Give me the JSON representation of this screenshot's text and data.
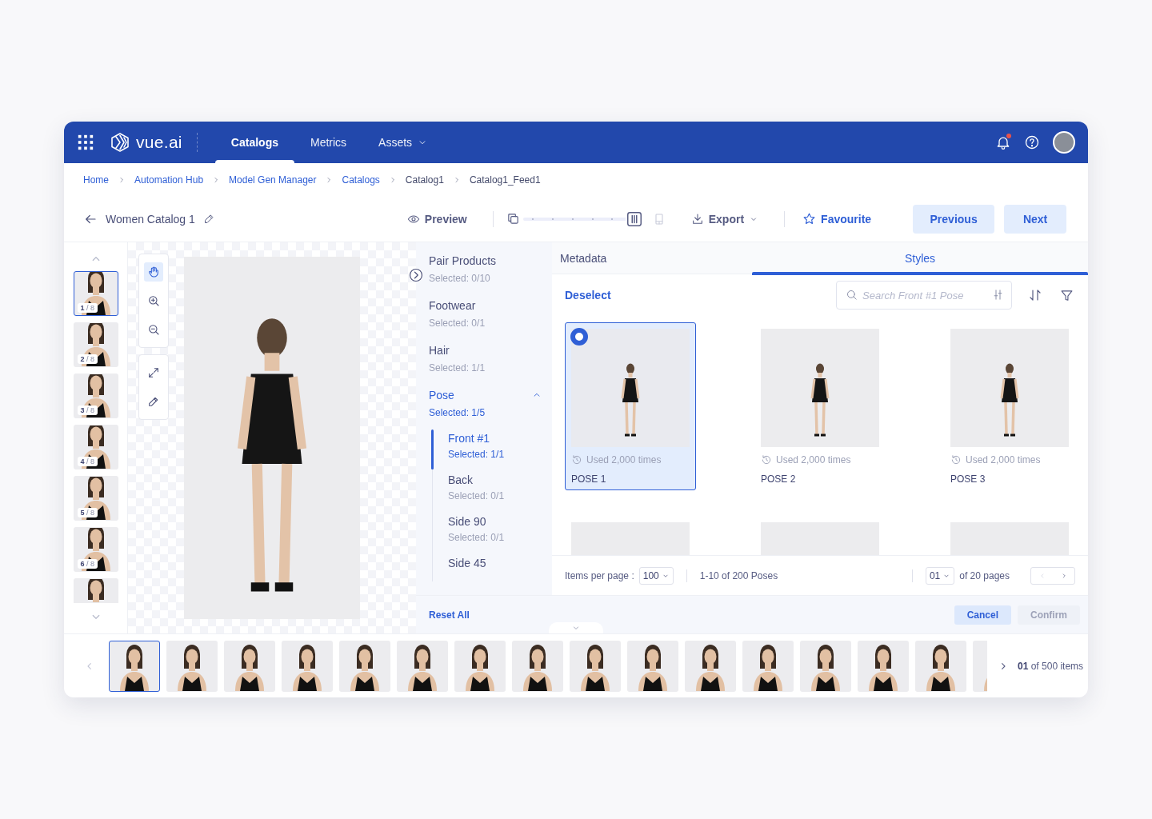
{
  "nav": {
    "brand": "vue.ai",
    "tabs": [
      {
        "label": "Catalogs",
        "selected": true,
        "dropdown": false
      },
      {
        "label": "Metrics",
        "selected": false,
        "dropdown": false
      },
      {
        "label": "Assets",
        "selected": false,
        "dropdown": true
      }
    ],
    "notifications_unread": true
  },
  "breadcrumbs": [
    {
      "label": "Home",
      "link": true
    },
    {
      "label": "Automation Hub",
      "link": true
    },
    {
      "label": "Model Gen Manager",
      "link": true
    },
    {
      "label": "Catalogs",
      "link": true
    },
    {
      "label": "Catalog1",
      "link": false
    },
    {
      "label": "Catalog1_Feed1",
      "link": false
    }
  ],
  "toolbar": {
    "title": "Women Catalog 1",
    "preview": "Preview",
    "zoom_slider": {
      "level": 1
    },
    "export": "Export",
    "favourite": "Favourite",
    "previous": "Previous",
    "next": "Next"
  },
  "view_thumbnails": [
    {
      "label": "**1** / 8",
      "selected": true
    },
    {
      "label": "**2** / 8",
      "selected": false
    },
    {
      "label": "**3** / 8",
      "selected": false
    },
    {
      "label": "**4** / 8",
      "selected": false
    },
    {
      "label": "**5** / 8",
      "selected": false
    },
    {
      "label": "**6** / 8",
      "selected": false
    },
    {
      "selected": false
    }
  ],
  "tool_groups": [
    [
      {
        "kind": "hand",
        "selected": true
      },
      {
        "kind": "zoom-in",
        "selected": false
      },
      {
        "kind": "zoom-out",
        "selected": false
      }
    ],
    [
      {
        "kind": "expand",
        "selected": false
      },
      {
        "kind": "edit",
        "selected": false
      }
    ]
  ],
  "categories": [
    {
      "name": "Pair Products",
      "count": "Selected: 0/10",
      "selected": false
    },
    {
      "name": "Footwear",
      "count": "Selected: 0/1",
      "selected": false
    },
    {
      "name": "Hair",
      "count": "Selected: 1/1",
      "selected": false
    },
    {
      "name": "Pose",
      "count": "Selected: 1/5",
      "selected": true,
      "expanded": true,
      "children": [
        {
          "name": "Front #1",
          "count": "Selected: 1/1",
          "selected": true
        },
        {
          "name": "Back",
          "count": "Selected: 0/1",
          "selected": false
        },
        {
          "name": "Side 90",
          "count": "Selected: 0/1",
          "selected": false
        },
        {
          "name": "Side 45",
          "selected": false
        }
      ]
    }
  ],
  "panel_tabs": [
    {
      "label": "Metadata",
      "selected": false
    },
    {
      "label": "Styles",
      "selected": true
    }
  ],
  "deselect": "Deselect",
  "search": {
    "placeholder": "Search Front #1 Pose"
  },
  "poses": [
    {
      "usage": "Used 2,000 times",
      "name": "POSE 1",
      "selected": true
    },
    {
      "usage": "Used 2,000 times",
      "name": "POSE 2",
      "selected": false
    },
    {
      "usage": "Used 2,000 times",
      "name": "POSE 3",
      "selected": false
    },
    {
      "selected": false
    },
    {
      "selected": false
    },
    {
      "selected": false
    }
  ],
  "pagination": {
    "per_page_label": "Items per page :",
    "per_page": "100",
    "range": "1-10 of 200 Poses",
    "page": "01",
    "pages": "of 20 pages"
  },
  "footer": {
    "reset": "Reset All",
    "cancel": "Cancel",
    "confirm": {
      "label": "Confirm",
      "disabled": true
    }
  },
  "filmstrip": {
    "items": [
      {
        "selected": true
      },
      {
        "selected": false
      },
      {
        "selected": false
      },
      {
        "selected": false
      },
      {
        "selected": false
      },
      {
        "selected": false
      },
      {
        "selected": false
      },
      {
        "selected": false
      },
      {
        "selected": false
      },
      {
        "selected": false
      },
      {
        "selected": false
      },
      {
        "selected": false
      },
      {
        "selected": false
      },
      {
        "selected": false
      },
      {
        "selected": false
      },
      {
        "selected": false
      }
    ],
    "counter": "**01** of 500 items"
  }
}
